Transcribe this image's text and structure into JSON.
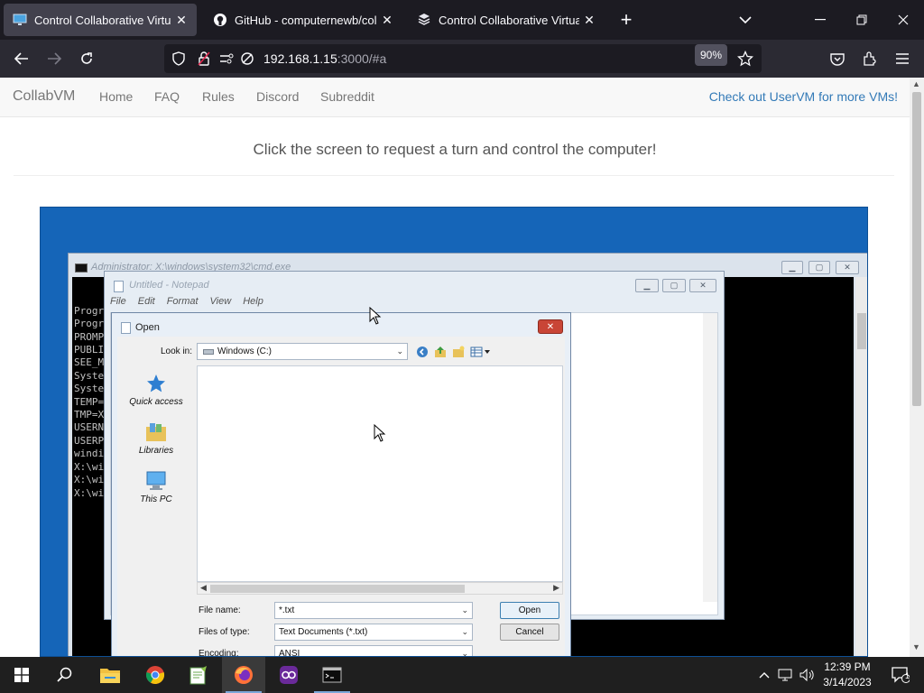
{
  "browser": {
    "tabs": [
      {
        "label": "Control Collaborative Virtual M",
        "active": true
      },
      {
        "label": "GitHub - computernewb/collab",
        "active": false
      },
      {
        "label": "Control Collaborative Virtual M",
        "active": false
      }
    ],
    "new_tab": "+",
    "url_host": "192.168.1.15",
    "url_rest": ":3000/#a",
    "zoom": "90%"
  },
  "site": {
    "brand": "CollabVM",
    "nav": [
      "Home",
      "FAQ",
      "Rules",
      "Discord",
      "Subreddit"
    ],
    "right_link": "Check out UserVM for more VMs!",
    "prompt": "Click the screen to request a turn and control the computer!"
  },
  "vm": {
    "cmd": {
      "title": "Administrator: X:\\windows\\system32\\cmd.exe",
      "lines": [
        "Progr",
        "Progr",
        "PROMP",
        "PUBLI",
        "SEE_M",
        "Syste",
        "Syste",
        "TEMP=",
        "TMP=X",
        "USERN",
        "USERP",
        "windi",
        "",
        "X:\\wi",
        "",
        "X:\\wi",
        "",
        "X:\\wi"
      ]
    },
    "notepad": {
      "title": "Untitled - Notepad",
      "menu": [
        "File",
        "Edit",
        "Format",
        "View",
        "Help"
      ]
    },
    "dialog": {
      "title": "Open",
      "look_in_label": "Look in:",
      "look_in_value": "Windows (C:)",
      "places": [
        "Quick access",
        "Libraries",
        "This PC"
      ],
      "file_name_label": "File name:",
      "file_name_value": "*.txt",
      "file_type_label": "Files of type:",
      "file_type_value": "Text Documents (*.txt)",
      "encoding_label": "Encoding:",
      "encoding_value": "ANSI",
      "open_label": "Open",
      "cancel_label": "Cancel"
    }
  },
  "taskbar": {
    "time": "12:39 PM",
    "date": "3/14/2023",
    "notification_count": "1"
  },
  "colors": {
    "tab_bg": "#1c1b22",
    "nav_bg": "#2b2a33",
    "vm_desktop": "#1565b8",
    "link": "#337ab7"
  }
}
